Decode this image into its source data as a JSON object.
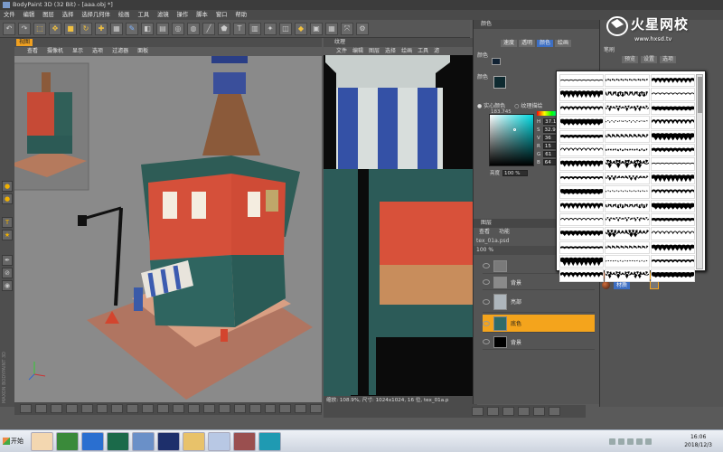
{
  "window": {
    "title": "BodyPaint 3D (32 Bit) - [aaa.obj *]"
  },
  "menubar": [
    "文件",
    "编辑",
    "图层",
    "选择",
    "选择几何体",
    "绘画",
    "工具",
    "滤镜",
    "操作",
    "脚本",
    "窗口",
    "帮助"
  ],
  "viewport": {
    "tab_label": "视图",
    "menu": [
      "查看",
      "摄像机",
      "显示",
      "选项",
      "过滤器",
      "面板"
    ]
  },
  "texture_view": {
    "title": "纹理",
    "menu": [
      "文件",
      "编辑",
      "图层",
      "选择",
      "绘画",
      "工具",
      "滤"
    ],
    "status": "缩放: 108.9%, 尺寸: 1024x1024, 16 位, tex_01a.p"
  },
  "color_panel": {
    "title": "颜色",
    "tabs": [
      "速度",
      "透明",
      "颜色",
      "绘画"
    ],
    "fg_label": "颜色",
    "bg_label": "颜色",
    "mode_options": [
      "实心颜色",
      "纹理描绘"
    ],
    "hex": "183.745",
    "channels": [
      {
        "label": "H",
        "value": "37.14"
      },
      {
        "label": "S",
        "value": "32.94"
      },
      {
        "label": "V",
        "value": "36"
      },
      {
        "label": "R",
        "value": "15"
      },
      {
        "label": "G",
        "value": "61"
      },
      {
        "label": "B",
        "value": "64"
      }
    ],
    "brightness_label": "亮度",
    "brightness_value": "100 %"
  },
  "layers_panel": {
    "title": "图层",
    "menu": [
      "查看",
      "功能"
    ],
    "file": "tex_01a.psd",
    "opacity": "100 %",
    "layers": [
      {
        "name": "",
        "thumb": "#7a7a7a"
      },
      {
        "name": "背景",
        "thumb": "#8a8a8a"
      },
      {
        "name": "亮部",
        "thumb": "#aeb6bc"
      },
      {
        "name": "底色",
        "thumb": "#2e6b69",
        "selected": true
      },
      {
        "name": "背景",
        "thumb": "#000000"
      }
    ]
  },
  "right_column": {
    "title": "笔刷",
    "tabs": [
      "预览",
      "设置",
      "选项"
    ],
    "materials": [
      {
        "name": "材质"
      },
      {
        "name": "材质"
      }
    ]
  },
  "watermark": {
    "title": "火星网校",
    "url": "www.hxsd.tv"
  },
  "taskbar": {
    "start": "开始",
    "time": "16:06",
    "date": "2018/12/3"
  },
  "colors": {
    "accent_orange": "#f4a41c",
    "accent_blue": "#3d6fc3",
    "wall_red": "#d8523a",
    "wall_teal": "#2f5f5a",
    "floor": "#c0836a"
  }
}
